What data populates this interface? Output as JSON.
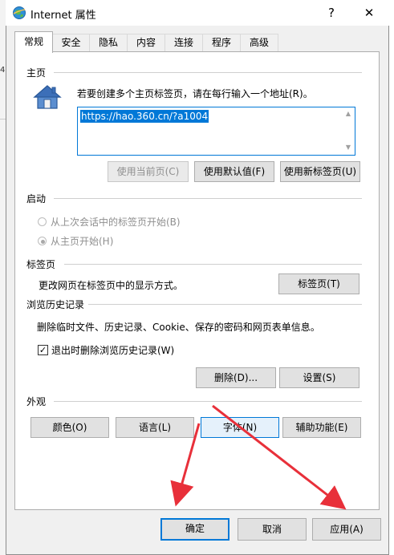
{
  "dialog": {
    "title": "Internet 属性",
    "help_glyph": "?",
    "close_glyph": "✕"
  },
  "tabs": [
    {
      "label": "常规",
      "active": true
    },
    {
      "label": "安全"
    },
    {
      "label": "隐私"
    },
    {
      "label": "内容"
    },
    {
      "label": "连接"
    },
    {
      "label": "程序"
    },
    {
      "label": "高级"
    }
  ],
  "home": {
    "section_label": "主页",
    "description": "若要创建多个主页标签页，请在每行输入一个地址(R)。",
    "url_value": "https://hao.360.cn/?a1004",
    "icon": "house-icon",
    "buttons": {
      "use_current": "使用当前页(C)",
      "use_default": "使用默认值(F)",
      "use_new_tab": "使用新标签页(U)"
    }
  },
  "startup": {
    "section_label": "启动",
    "option_last_session": "从上次会话中的标签页开始(B)",
    "option_home": "从主页开始(H)",
    "selected": "option_home"
  },
  "tabs_section": {
    "section_label": "标签页",
    "description": "更改网页在标签页中的显示方式。",
    "button": "标签页(T)"
  },
  "history": {
    "section_label": "浏览历史记录",
    "description": "删除临时文件、历史记录、Cookie、保存的密码和网页表单信息。",
    "checkbox_label": "退出时删除浏览历史记录(W)",
    "checkbox_checked": true,
    "checkbox_glyph": "✓",
    "delete_button": "删除(D)...",
    "settings_button": "设置(S)"
  },
  "appearance": {
    "section_label": "外观",
    "colors_button": "颜色(O)",
    "languages_button": "语言(L)",
    "fonts_button": "字体(N)",
    "accessibility_button": "辅助功能(E)"
  },
  "footer": {
    "ok_button": "确定",
    "cancel_button": "取消",
    "apply_button": "应用(A)"
  },
  "colors": {
    "accent": "#0078d7",
    "annotation_arrow": "#e8303a"
  }
}
